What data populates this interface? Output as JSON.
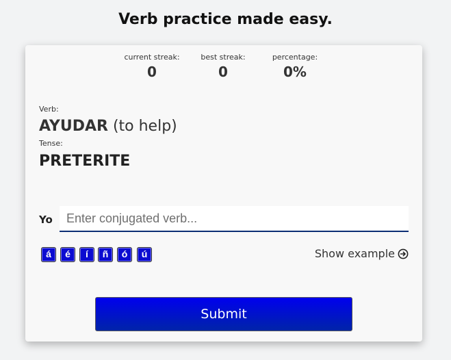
{
  "page": {
    "title": "Verb practice made easy."
  },
  "stats": {
    "current_streak": {
      "label": "current streak:",
      "value": "0"
    },
    "best_streak": {
      "label": "best streak:",
      "value": "0"
    },
    "percentage": {
      "label": "percentage:",
      "value": "0%"
    }
  },
  "verb": {
    "label": "Verb:",
    "name": "AYUDAR",
    "translation": "(to help)"
  },
  "tense": {
    "label": "Tense:",
    "value": "PRETERITE"
  },
  "answer": {
    "pronoun": "Yo",
    "placeholder": "Enter conjugated verb...",
    "value": ""
  },
  "accents": [
    "á",
    "é",
    "í",
    "ñ",
    "ó",
    "ú"
  ],
  "show_example": {
    "label": "Show example",
    "icon": "circle-arrow-right-icon"
  },
  "submit": {
    "label": "Submit"
  },
  "colors": {
    "button_blue": "#0000ee",
    "input_underline": "#0b2e74"
  }
}
